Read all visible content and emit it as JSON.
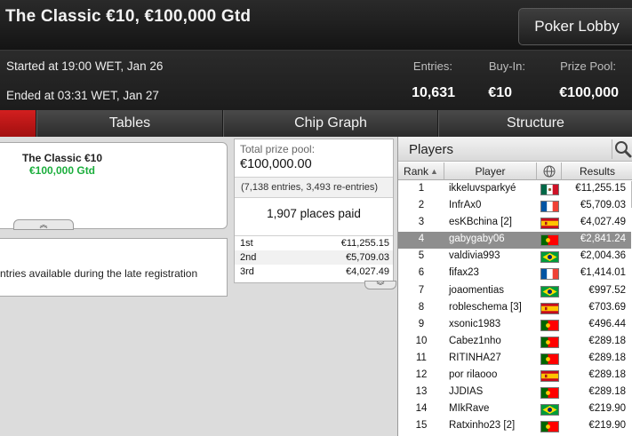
{
  "window": {
    "title": "The Classic €10, €100,000 Gtd",
    "lobby_button": "Poker Lobby"
  },
  "info": {
    "started": "Started at 19:00 WET, Jan 26",
    "ended": "Ended at 03:31 WET, Jan 27",
    "entries_label": "Entries:",
    "entries_value": "10,631",
    "buyin_label": "Buy-In:",
    "buyin_value": "€10",
    "prizepool_label": "Prize Pool:",
    "prizepool_value": "€100,000"
  },
  "tabs": [
    {
      "label": ""
    },
    {
      "label": "Tables"
    },
    {
      "label": "Chip Graph"
    },
    {
      "label": "Structure"
    }
  ],
  "info_card": {
    "name": "The Classic €10",
    "guarantee": "€100,000 Gtd",
    "expand_glyph": "︽"
  },
  "late_reg_text": "ntries available during the late registration",
  "prize_panel": {
    "total_label": "Total prize pool:",
    "total_value": "€100,000.00",
    "entries_note": "(7,138 entries, 3,493 re-entries)",
    "places_paid": "1,907 places paid",
    "payouts": [
      {
        "place": "1st",
        "amount": "€11,255.15"
      },
      {
        "place": "2nd",
        "amount": "€5,709.03"
      },
      {
        "place": "3rd",
        "amount": "€4,027.49"
      }
    ],
    "collapse_glyph": "︾"
  },
  "players_panel": {
    "title": "Players",
    "search_icon": "magnifier-icon",
    "columns": {
      "rank": "Rank",
      "player": "Player",
      "results": "Results"
    },
    "selected_rank": 4,
    "rows": [
      {
        "rank": "1",
        "name": "ikkeluvsparkyé",
        "country": "mexico",
        "result": "€11,255.15"
      },
      {
        "rank": "2",
        "name": "InfrAx0",
        "country": "france",
        "result": "€5,709.03"
      },
      {
        "rank": "3",
        "name": "esKBchina [2]",
        "country": "spain",
        "result": "€4,027.49"
      },
      {
        "rank": "4",
        "name": "gabygaby06",
        "country": "portugal",
        "result": "€2,841.24"
      },
      {
        "rank": "5",
        "name": "valdivia993",
        "country": "brazil",
        "result": "€2,004.36"
      },
      {
        "rank": "6",
        "name": "fifax23",
        "country": "france",
        "result": "€1,414.01"
      },
      {
        "rank": "7",
        "name": "joaomentias",
        "country": "brazil",
        "result": "€997.52"
      },
      {
        "rank": "8",
        "name": "robleschema [3]",
        "country": "spain",
        "result": "€703.69"
      },
      {
        "rank": "9",
        "name": "xsonic1983",
        "country": "portugal",
        "result": "€496.44"
      },
      {
        "rank": "10",
        "name": "Cabez1nho",
        "country": "portugal",
        "result": "€289.18"
      },
      {
        "rank": "11",
        "name": "RITINHA27",
        "country": "portugal",
        "result": "€289.18"
      },
      {
        "rank": "12",
        "name": "por rilaooo",
        "country": "spain",
        "result": "€289.18"
      },
      {
        "rank": "13",
        "name": "JJDIAS",
        "country": "portugal",
        "result": "€289.18"
      },
      {
        "rank": "14",
        "name": "MIkRave",
        "country": "brazil",
        "result": "€219.90"
      },
      {
        "rank": "15",
        "name": "Ratxinho23 [2]",
        "country": "portugal",
        "result": "€219.90"
      }
    ]
  },
  "colors": {
    "accent_red": "#c0141b",
    "gtd_green": "#1bae3c",
    "selected_row": "#8e8e8e"
  }
}
